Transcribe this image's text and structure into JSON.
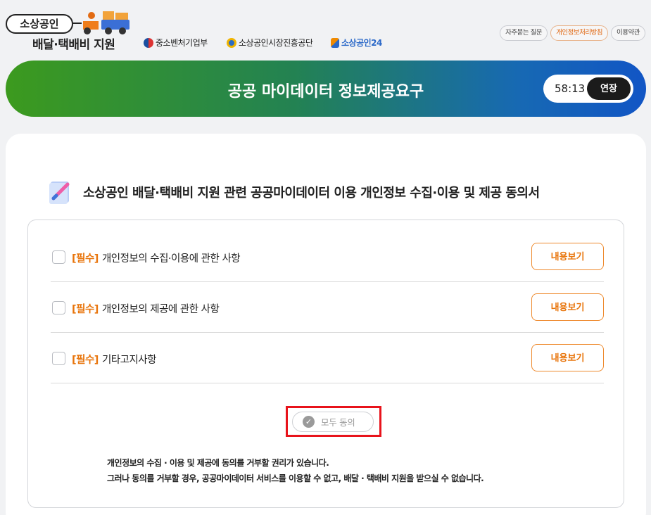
{
  "header": {
    "brand_pill": "소상공인",
    "brand_sub": "배달·택배비 지원",
    "orgs": [
      "중소벤처기업부",
      "소상공인시장진흥공단",
      "소상공인24"
    ],
    "links": [
      "자주묻는 질문",
      "개인정보처리방침",
      "이용약관"
    ]
  },
  "banner": {
    "title": "공공 마이데이터 정보제공요구",
    "timer": "58:13",
    "extend_label": "연장"
  },
  "section": {
    "title": "소상공인 배달·택배비 지원 관련 공공마이데이터 이용 개인정보 수집·이용 및 제공 동의서"
  },
  "agreements": [
    {
      "req": "[필수]",
      "label": "개인정보의 수집·이용에 관한 사항",
      "button": "내용보기"
    },
    {
      "req": "[필수]",
      "label": "개인정보의 제공에 관한 사항",
      "button": "내용보기"
    },
    {
      "req": "[필수]",
      "label": "기타고지사항",
      "button": "내용보기"
    }
  ],
  "agree_all": {
    "label": "모두 동의",
    "check": "✓"
  },
  "notice": [
    "개인정보의 수집 · 이용 및 제공에 동의를 거부할 권리가 있습니다.",
    "그러나 동의를 거부할 경우, 공공마이데이터 서비스를 이용할 수 없고, 배달 · 택배비 지원을 받으실 수 없습니다."
  ],
  "colors": {
    "accent": "#e8740a",
    "highlight": "#e8131b"
  }
}
